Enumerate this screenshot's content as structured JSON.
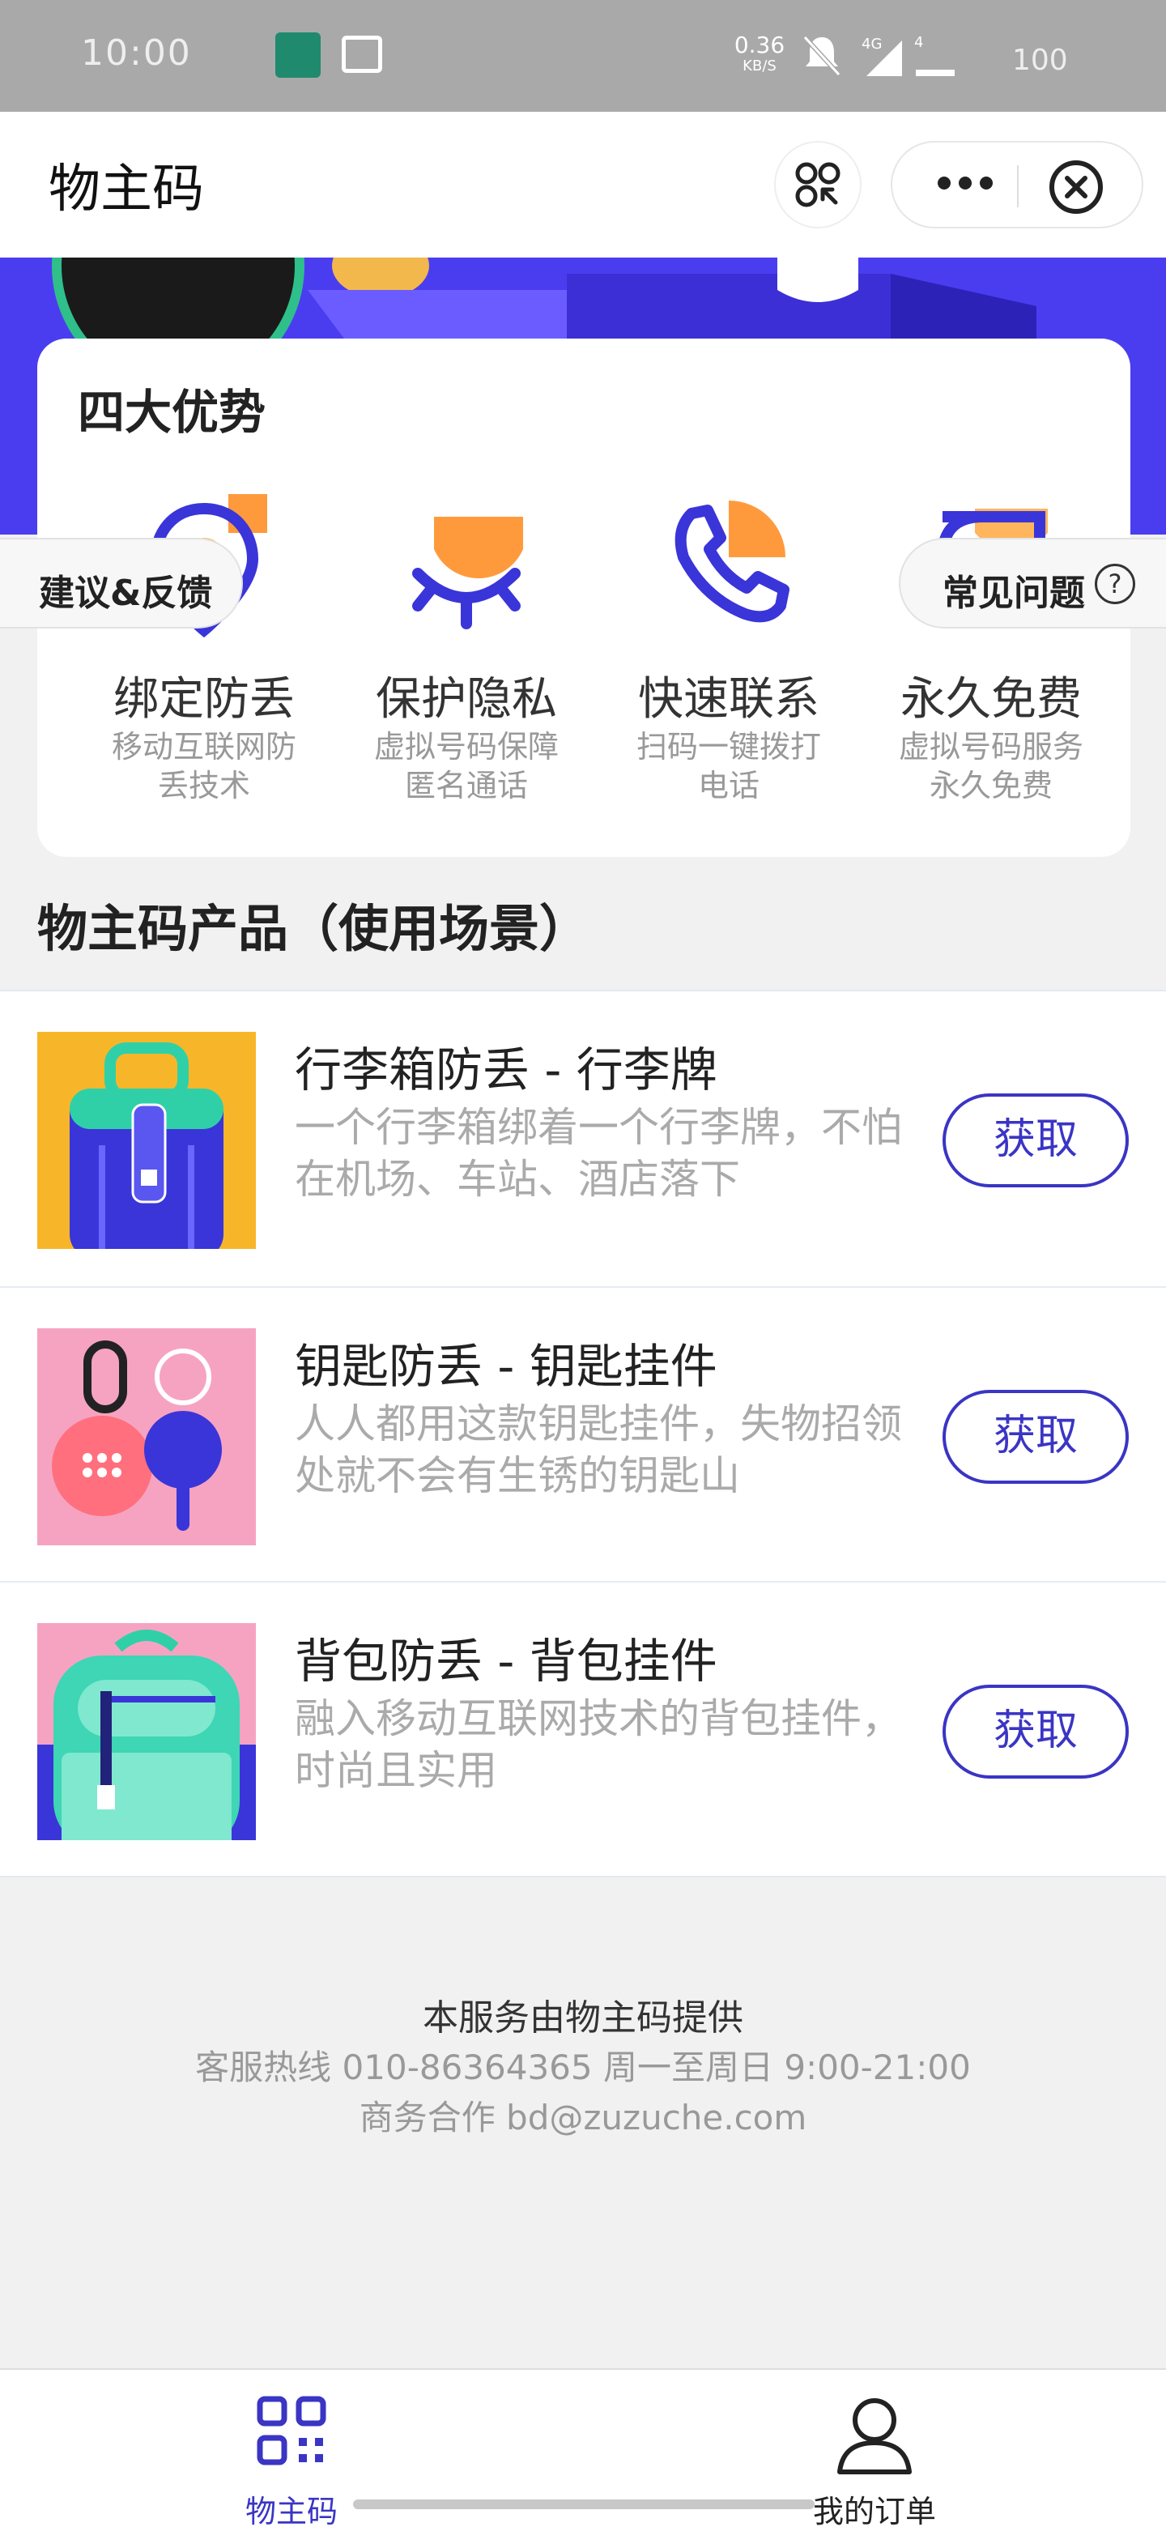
{
  "status_bar": {
    "time": "10:00",
    "net_speed": "0.36",
    "net_unit": "KB/S",
    "battery": "100",
    "sig_label": "4G",
    "sig2_label": "4"
  },
  "header": {
    "title": "物主码"
  },
  "advantages": {
    "title": "四大优势",
    "items": [
      {
        "name": "绑定防丢",
        "desc": "移动互联网防丢技术"
      },
      {
        "name": "保护隐私",
        "desc": "虚拟号码保障匿名通话"
      },
      {
        "name": "快速联系",
        "desc": "扫码一键拨打电话"
      },
      {
        "name": "永久免费",
        "desc": "虚拟号码服务永久免费"
      }
    ]
  },
  "floating": {
    "feedback": "建议&反馈",
    "faq": "常见问题",
    "faq_icon": "?"
  },
  "section_title": "物主码产品（使用场景）",
  "products": [
    {
      "title": "行李箱防丢 - 行李牌",
      "desc": "一个行李箱绑着一个行李牌，不怕在机场、车站、酒店落下",
      "button": "获取"
    },
    {
      "title": "钥匙防丢 - 钥匙挂件",
      "desc": "人人都用这款钥匙挂件，失物招领处就不会有生锈的钥匙山",
      "button": "获取"
    },
    {
      "title": "背包防丢 - 背包挂件",
      "desc": "融入移动互联网技术的背包挂件，时尚且实用",
      "button": "获取"
    }
  ],
  "footer": {
    "provider": "本服务由物主码提供",
    "hotline": "客服热线 010-86364365 周一至周日 9:00-21:00",
    "business": "商务合作 bd@zuzuche.com"
  },
  "tabbar": {
    "tabs": [
      {
        "label": "物主码",
        "icon": "qrcode-icon",
        "active": true
      },
      {
        "label": "我的订单",
        "icon": "user-icon",
        "active": false
      }
    ]
  },
  "colors": {
    "accent": "#3a35c4",
    "banner": "#4a3df0",
    "orange": "#ff9a3c"
  }
}
